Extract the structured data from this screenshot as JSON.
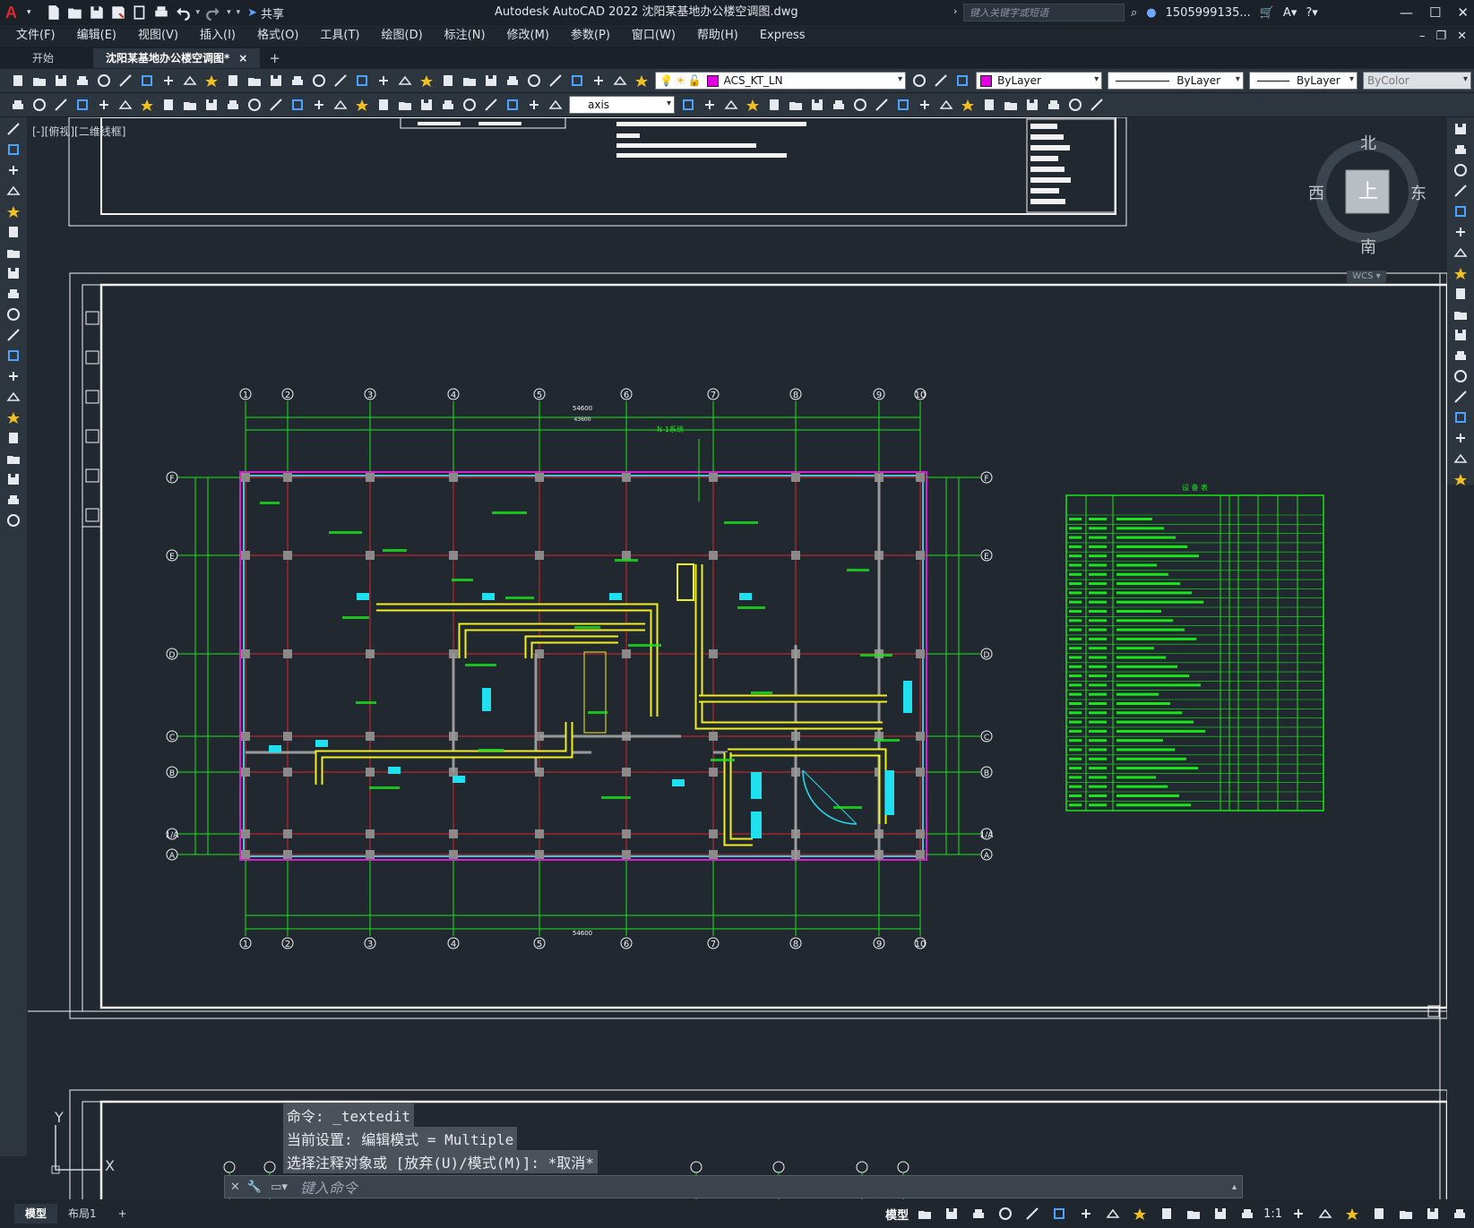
{
  "app": {
    "title": "Autodesk AutoCAD 2022    沈阳某基地办公楼空调图.dwg",
    "search_placeholder": "键入关键字或短语",
    "user": "1505999135...",
    "share_label": "共享",
    "logo": "A"
  },
  "menu": [
    "文件(F)",
    "编辑(E)",
    "视图(V)",
    "插入(I)",
    "格式(O)",
    "工具(T)",
    "绘图(D)",
    "标注(N)",
    "修改(M)",
    "参数(P)",
    "窗口(W)",
    "帮助(H)",
    "Express"
  ],
  "tabs": {
    "start": "开始",
    "active": "沈阳某基地办公楼空调图*",
    "close": "×",
    "add": "+"
  },
  "toolbar": {
    "layer": "ACS_KT_LN",
    "layer_color": "#e000e0",
    "color": "ByLayer",
    "linetype": "ByLayer",
    "lineweight": "ByLayer",
    "plotstyle": "ByColor",
    "dimstyle": "axis"
  },
  "viewport": {
    "label": "[-][俯视][二维线框]"
  },
  "viewcube": {
    "north": "北",
    "south": "南",
    "east": "东",
    "west": "西",
    "top": "上",
    "wcs": "WCS"
  },
  "drawing": {
    "dim_total": "54600",
    "dim_total2": "43600",
    "column_axes": [
      "1",
      "2",
      "3",
      "4",
      "5",
      "6",
      "7",
      "8",
      "9",
      "10"
    ],
    "row_axes": [
      "F",
      "E",
      "D",
      "C",
      "B",
      "1/A",
      "A"
    ],
    "system_label": "N-1系统",
    "schedule_title": "设 备 表"
  },
  "command": {
    "history": [
      "命令: _textedit",
      "当前设置: 编辑模式 = Multiple",
      "选择注释对象或 [放弃(U)/模式(M)]: *取消*"
    ],
    "placeholder": "键入命令"
  },
  "ucs": {
    "y": "Y",
    "x": "X"
  },
  "status": {
    "tabs": [
      "模型",
      "布局1"
    ],
    "add": "+",
    "model_label": "模型",
    "scale": "1:1"
  },
  "colors": {
    "background": "#212830",
    "grid_red": "#e0242a",
    "dim_green": "#19e619",
    "duct_yellow": "#f0f020",
    "cyan": "#20e0f0"
  }
}
